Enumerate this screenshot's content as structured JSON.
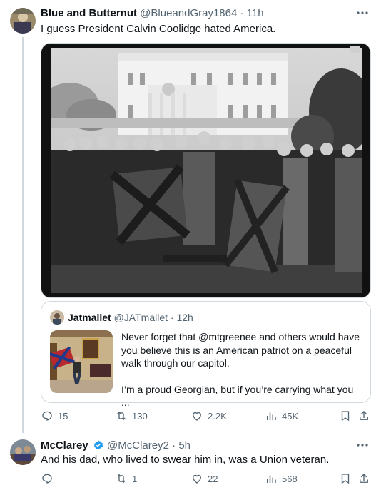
{
  "tweet1": {
    "name": "Blue and Butternut",
    "handle": "@BlueandGray1864",
    "sep": "·",
    "time": "11h",
    "text": "I guess President Calvin Coolidge hated America.",
    "quote": {
      "name": "Jatmallet",
      "handle": "@JATmallet",
      "sep": "·",
      "time": "12h",
      "para1": "Never forget that @mtgreenee and others would have you believe this is an American patriot on a peaceful walk through our capitol.",
      "para2": "I’m a proud Georgian, but if you’re carrying what you ..."
    },
    "actions": {
      "replies": "15",
      "reposts": "130",
      "likes": "2.2K",
      "views": "45K"
    }
  },
  "tweet2": {
    "name": "McClarey",
    "handle": "@McClarey2",
    "sep": "·",
    "time": "5h",
    "text": "And his dad, who lived to swear him in, was a Union veteran.",
    "actions": {
      "replies": "",
      "reposts": "1",
      "likes": "22",
      "views": "568"
    }
  },
  "icons": {
    "more": "more-icon",
    "reply": "reply-icon",
    "repost": "repost-icon",
    "like": "heart-icon",
    "views": "views-icon",
    "bookmark": "bookmark-icon",
    "share": "share-icon",
    "verified": "verified-badge-icon"
  },
  "colors": {
    "secondary_text": "#536471",
    "verified": "#1d9bf0",
    "border": "#cfd9de"
  }
}
